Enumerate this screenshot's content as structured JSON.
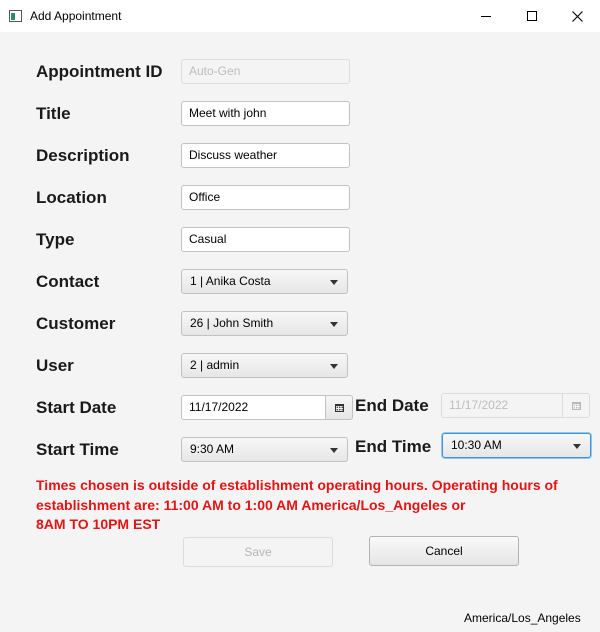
{
  "window": {
    "title": "Add Appointment",
    "icon": "app-window-icon",
    "controls": [
      "minimize-icon",
      "maximize-icon",
      "close-icon"
    ]
  },
  "form": {
    "appointment_id": {
      "label": "Appointment ID",
      "placeholder": "Auto-Gen",
      "value": ""
    },
    "title": {
      "label": "Title",
      "value": "Meet with john"
    },
    "description": {
      "label": "Description",
      "value": "Discuss weather"
    },
    "location": {
      "label": "Location",
      "value": "Office"
    },
    "type": {
      "label": "Type",
      "value": "Casual"
    },
    "contact": {
      "label": "Contact",
      "selected": "1 | Anika Costa"
    },
    "customer": {
      "label": "Customer",
      "selected": "26 | John Smith"
    },
    "user": {
      "label": "User",
      "selected": "2 | admin"
    },
    "start_date": {
      "label": "Start Date",
      "value": "11/17/2022"
    },
    "end_date": {
      "label": "End Date",
      "value": "11/17/2022"
    },
    "start_time": {
      "label": "Start Time",
      "selected": "9:30 AM"
    },
    "end_time": {
      "label": "End Time",
      "selected": "10:30 AM"
    }
  },
  "error": {
    "line1": "Times chosen is outside of establishment operating hours. Operating hours of",
    "line2": "establishment are: 11:00 AM to 1:00 AM America/Los_Angeles or",
    "line3": "8AM TO 10PM EST",
    "color": "#e31414"
  },
  "buttons": {
    "save": "Save",
    "cancel": "Cancel"
  },
  "timezone": "America/Los_Angeles",
  "colors": {
    "focus": "#3a94d6",
    "background": "#f4f4f4"
  }
}
